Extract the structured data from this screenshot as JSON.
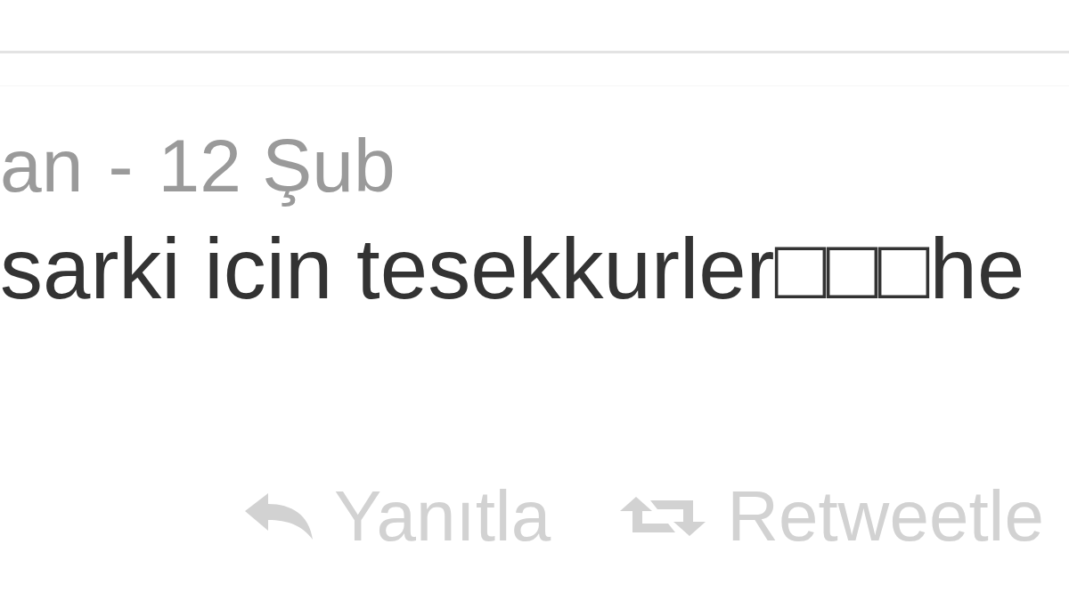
{
  "tweet": {
    "author": "an",
    "separator": "-",
    "date": "12 Şub",
    "text": "sarki icin tesekkurler□□□he",
    "actions": [
      {
        "kind": "reply",
        "label": "Yanıtla"
      },
      {
        "kind": "retweet",
        "label": "Retweetle"
      }
    ]
  }
}
